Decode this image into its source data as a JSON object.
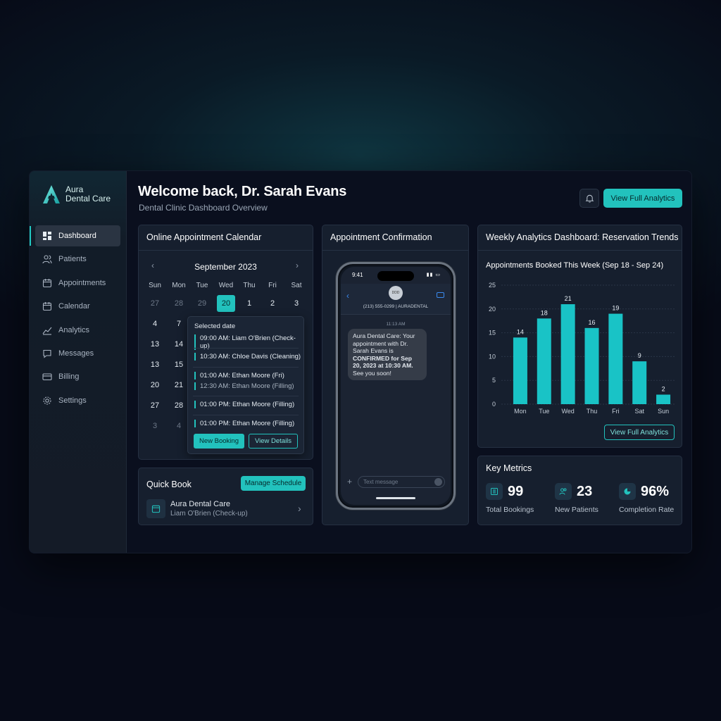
{
  "brand": {
    "line1": "Aura",
    "line2": "Dental Care"
  },
  "sidebar": {
    "items": [
      {
        "label": "Dashboard",
        "icon": "dashboard-icon",
        "active": true
      },
      {
        "label": "Patients",
        "icon": "patients-icon"
      },
      {
        "label": "Appointments",
        "icon": "appointments-icon"
      },
      {
        "label": "Calendar",
        "icon": "calendar-icon"
      },
      {
        "label": "Analytics",
        "icon": "analytics-icon"
      },
      {
        "label": "Messages",
        "icon": "messages-icon"
      },
      {
        "label": "Billing",
        "icon": "billing-icon"
      },
      {
        "label": "Settings",
        "icon": "settings-icon"
      }
    ]
  },
  "header": {
    "title": "Welcome back, Dr. Sarah Evans",
    "subtitle": "Dental Clinic Dashboard Overview",
    "analytics_button": "View Full Analytics"
  },
  "calendar": {
    "title": "Online Appointment Calendar",
    "month": "September 2023",
    "weekdays": [
      "Sun",
      "Mon",
      "Tue",
      "Wed",
      "Thu",
      "Fri",
      "Sat"
    ],
    "row1": [
      "27",
      "28",
      "29",
      "20",
      "1",
      "2",
      "3"
    ],
    "col_sun": [
      "4",
      "13",
      "13",
      "20",
      "27",
      "3"
    ],
    "col_mon": [
      "7",
      "14",
      "15",
      "21",
      "28",
      "4"
    ],
    "popover": {
      "title": "Selected date",
      "slots": [
        "09:00 AM: Liam O'Brien (Check-up)",
        "10:30 AM: Chloe Davis (Cleaning)",
        "01:00 AM: Ethan Moore (Fri)",
        "12:30 AM: Ethan Moore (Filling)",
        "01:00 PM: Ethan Moore (Filling)",
        "01:00 PM: Ethan Moore (Filling)"
      ],
      "new_booking": "New Booking",
      "view_details": "View Details"
    }
  },
  "quickbook": {
    "title": "Quick Book",
    "manage_button": "Manage Schedule",
    "item_name": "Aura Dental Care",
    "item_sub": "Liam O'Brien (Check-up)"
  },
  "confirmation": {
    "title": "Appointment Confirmation",
    "phone": {
      "time": "9:41",
      "avatar_text": "DDD",
      "contact": "(213) 555-0299 | AURADENTAL",
      "stamp": "11:13 AM",
      "message_plain": "Aura Dental Care: Your appointment with Dr. Sarah Evans is",
      "message_bold": "CONFIRMED for Sep 20, 2023 at 10:30 AM.",
      "message_tail": "See you soon!",
      "input_placeholder": "Text message"
    }
  },
  "analytics": {
    "title": "Weekly Analytics Dashboard: Reservation Trends",
    "button": "View Full Analytics"
  },
  "chart_data": {
    "type": "bar",
    "title": "Appointments Booked This Week (Sep 18 - Sep 24)",
    "categories": [
      "Mon",
      "Tue",
      "Wed",
      "Thu",
      "Fri",
      "Sat",
      "Sun"
    ],
    "values": [
      14,
      18,
      21,
      16,
      19,
      9,
      2
    ],
    "ylim": [
      0,
      25
    ],
    "yticks": [
      0,
      5,
      10,
      15,
      20,
      25
    ],
    "grid": true,
    "color": "#19c3c6"
  },
  "metrics": {
    "title": "Key Metrics",
    "items": [
      {
        "value": "99",
        "label": "Total Bookings",
        "icon": "bookings-icon"
      },
      {
        "value": "23",
        "label": "New Patients",
        "icon": "new-patients-icon"
      },
      {
        "value": "96%",
        "label": "Completion Rate",
        "icon": "completion-icon"
      }
    ]
  },
  "colors": {
    "accent": "#22c2bd",
    "background": "#0a0f1e",
    "card": "#161f2e"
  }
}
